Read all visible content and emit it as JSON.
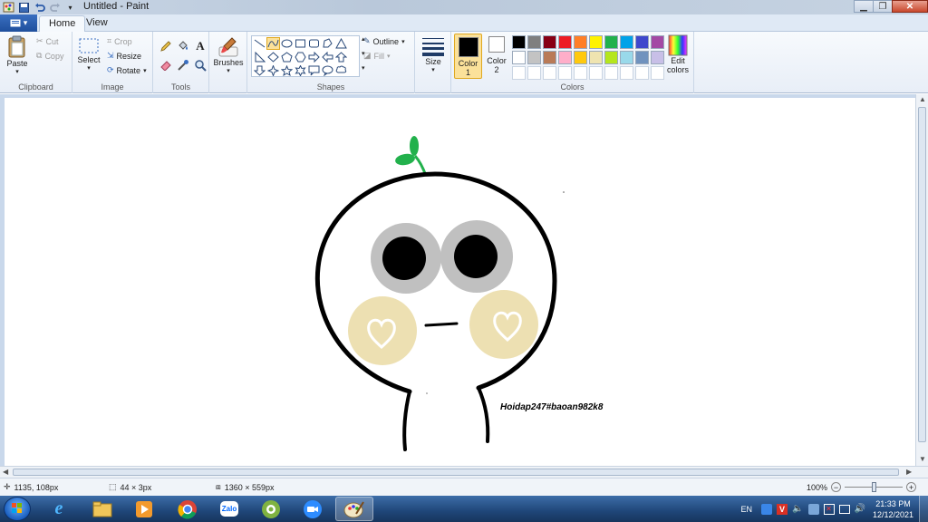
{
  "window": {
    "title": "Untitled - Paint"
  },
  "tabs": [
    "Home",
    "View"
  ],
  "ribbon": {
    "clipboard": {
      "label": "Clipboard",
      "paste": "Paste",
      "cut": "Cut",
      "copy": "Copy"
    },
    "image": {
      "label": "Image",
      "select": "Select",
      "crop": "Crop",
      "resize": "Resize",
      "rotate": "Rotate"
    },
    "tools": {
      "label": "Tools"
    },
    "brushes": {
      "label": "Brushes"
    },
    "shapes": {
      "label": "Shapes",
      "outline": "Outline",
      "fill": "Fill"
    },
    "size": {
      "label": "Size"
    },
    "colors": {
      "label": "Colors",
      "color1": "Color\n1",
      "color2": "Color\n2",
      "edit": "Edit colors",
      "color1_value": "#000000",
      "color2_value": "#ffffff",
      "palette_row1": [
        "#000000",
        "#7f7f7f",
        "#880015",
        "#ed1c24",
        "#ff7f27",
        "#fff200",
        "#22b14c",
        "#00a2e8",
        "#3f48cc",
        "#a349a4"
      ],
      "palette_row2": [
        "#ffffff",
        "#c3c3c3",
        "#b97a57",
        "#ffaec9",
        "#ffc90e",
        "#efe4b0",
        "#b5e61d",
        "#99d9ea",
        "#7092be",
        "#c8bfe7"
      ]
    }
  },
  "canvas": {
    "signature_text": "Hoidap247#baoan982k8",
    "cheek_color": "#ede0b2",
    "eye_ring_color": "#c0c0c0",
    "sprout_color": "#22b14c"
  },
  "statusbar": {
    "cursor_pos": "1135, 108px",
    "selection_size": "44 × 3px",
    "image_size": "1360 × 559px",
    "zoom": "100%"
  },
  "taskbar": {
    "language": "EN",
    "time": "21:33 PM",
    "date": "12/12/2021"
  }
}
